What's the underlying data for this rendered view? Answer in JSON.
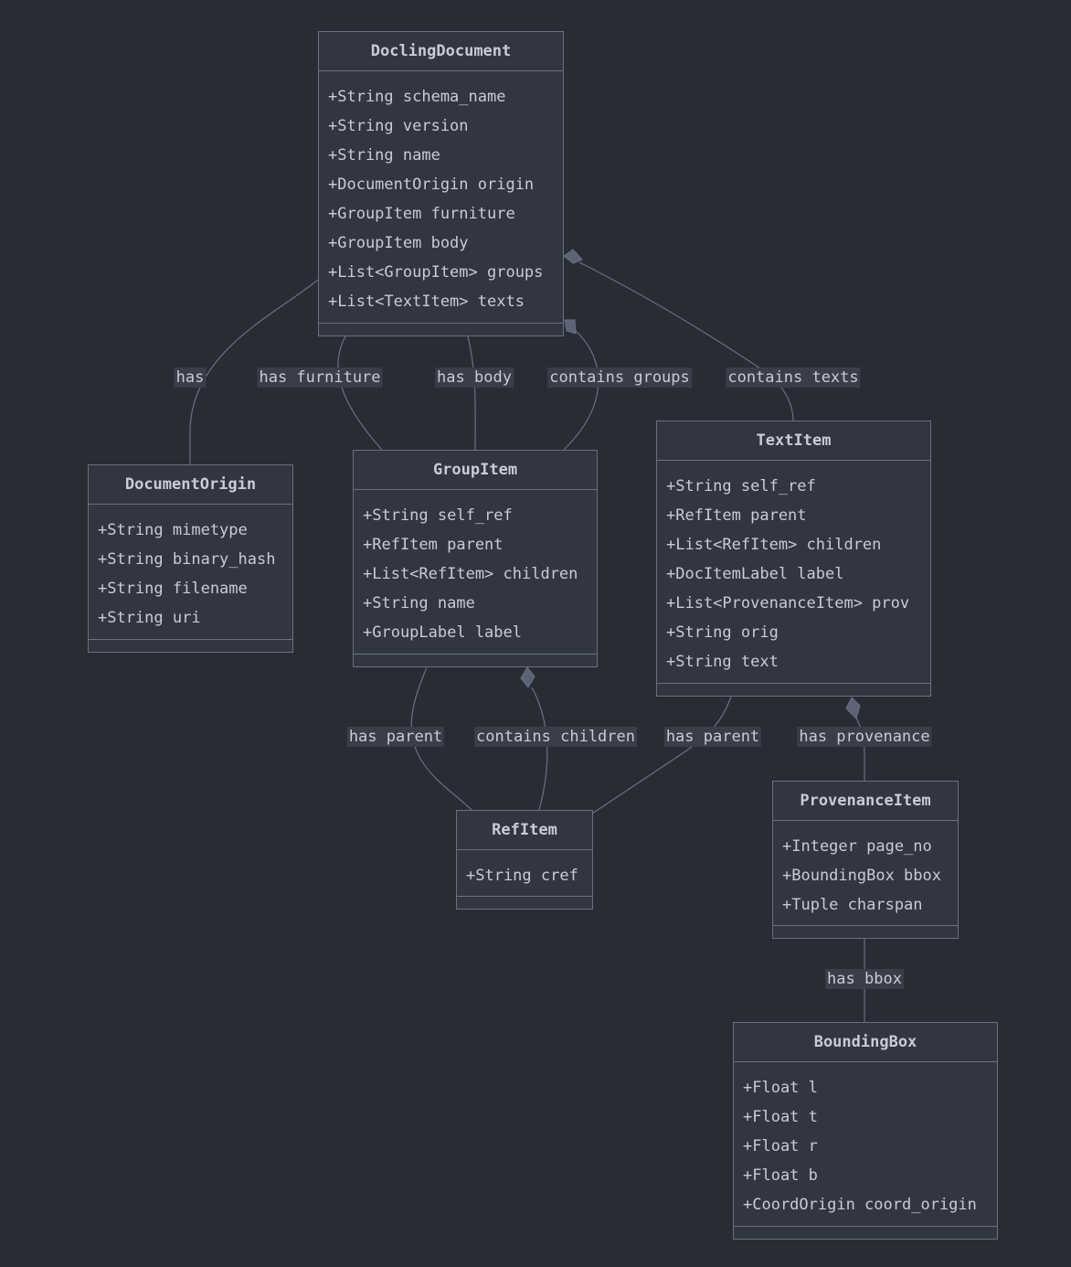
{
  "classes": {
    "DoclingDocument": {
      "name": "DoclingDocument",
      "attributes": [
        "+String schema_name",
        "+String version",
        "+String name",
        "+DocumentOrigin origin",
        "+GroupItem furniture",
        "+GroupItem body",
        "+List<GroupItem> groups",
        "+List<TextItem> texts"
      ]
    },
    "DocumentOrigin": {
      "name": "DocumentOrigin",
      "attributes": [
        "+String mimetype",
        "+String binary_hash",
        "+String filename",
        "+String uri"
      ]
    },
    "GroupItem": {
      "name": "GroupItem",
      "attributes": [
        "+String self_ref",
        "+RefItem parent",
        "+List<RefItem> children",
        "+String name",
        "+GroupLabel label"
      ]
    },
    "TextItem": {
      "name": "TextItem",
      "attributes": [
        "+String self_ref",
        "+RefItem parent",
        "+List<RefItem> children",
        "+DocItemLabel label",
        "+List<ProvenanceItem> prov",
        "+String orig",
        "+String text"
      ]
    },
    "RefItem": {
      "name": "RefItem",
      "attributes": [
        "+String cref"
      ]
    },
    "ProvenanceItem": {
      "name": "ProvenanceItem",
      "attributes": [
        "+Integer page_no",
        "+BoundingBox bbox",
        "+Tuple charspan"
      ]
    },
    "BoundingBox": {
      "name": "BoundingBox",
      "attributes": [
        "+Float l",
        "+Float t",
        "+Float r",
        "+Float b",
        "+CoordOrigin coord_origin"
      ]
    }
  },
  "relations": [
    {
      "id": "origin",
      "from": "DoclingDocument",
      "to": "DocumentOrigin",
      "label": "has",
      "type": "association"
    },
    {
      "id": "furniture",
      "from": "DoclingDocument",
      "to": "GroupItem",
      "label": "has furniture",
      "type": "association"
    },
    {
      "id": "body",
      "from": "DoclingDocument",
      "to": "GroupItem",
      "label": "has body",
      "type": "association"
    },
    {
      "id": "groups",
      "from": "DoclingDocument",
      "to": "GroupItem",
      "label": "contains groups",
      "type": "composition"
    },
    {
      "id": "texts",
      "from": "DoclingDocument",
      "to": "TextItem",
      "label": "contains texts",
      "type": "composition"
    },
    {
      "id": "group-parent",
      "from": "GroupItem",
      "to": "RefItem",
      "label": "has parent",
      "type": "association"
    },
    {
      "id": "group-children",
      "from": "GroupItem",
      "to": "RefItem",
      "label": "contains children",
      "type": "composition"
    },
    {
      "id": "text-parent",
      "from": "TextItem",
      "to": "RefItem",
      "label": "has parent",
      "type": "association"
    },
    {
      "id": "text-prov",
      "from": "TextItem",
      "to": "ProvenanceItem",
      "label": "has provenance",
      "type": "composition"
    },
    {
      "id": "prov-bbox",
      "from": "ProvenanceItem",
      "to": "BoundingBox",
      "label": "has bbox",
      "type": "association"
    }
  ],
  "colors": {
    "background": "#282c35",
    "box_fill": "#323641",
    "line": "#6b7080",
    "label_bg": "#3a3e49",
    "text": "#c8ccd4"
  }
}
